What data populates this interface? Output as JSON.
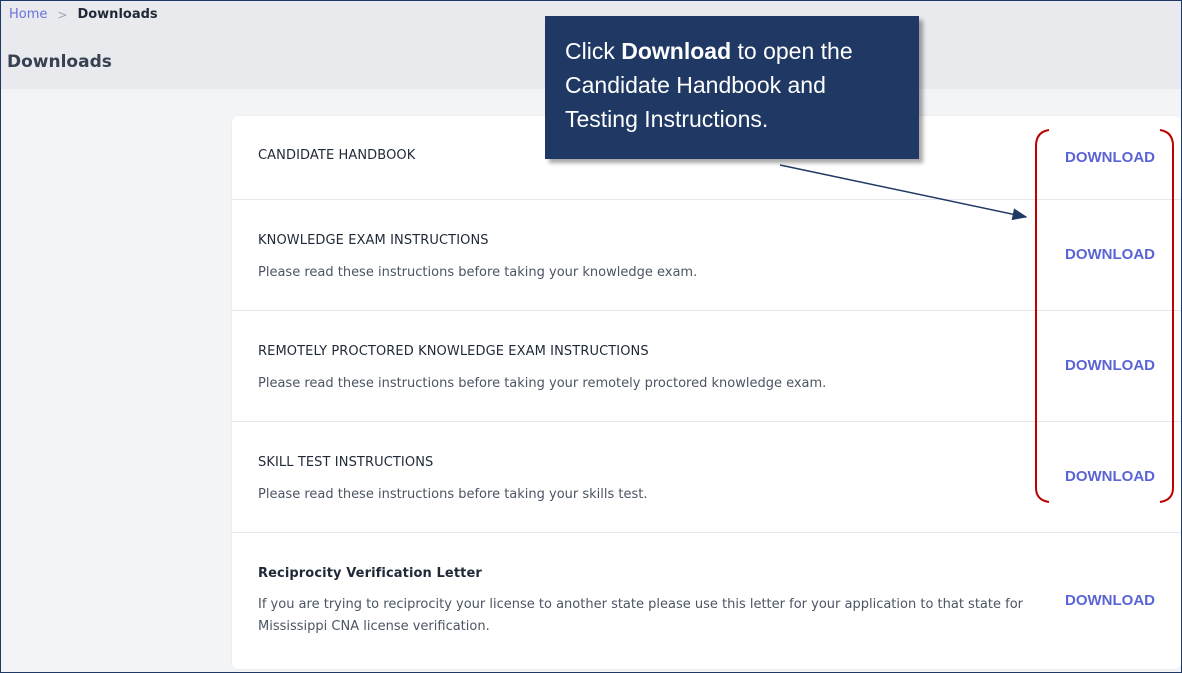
{
  "breadcrumb": {
    "home": "Home",
    "separator": ">",
    "current": "Downloads"
  },
  "page": {
    "title": "Downloads"
  },
  "callout": {
    "prefix": "Click ",
    "bold": "Download",
    "rest": " to open the Candidate Handbook and Testing Instructions."
  },
  "downloads": {
    "rows": [
      {
        "title": "CANDIDATE HANDBOOK",
        "description": "",
        "button": "DOWNLOAD"
      },
      {
        "title": "KNOWLEDGE EXAM INSTRUCTIONS",
        "description": "Please read these instructions before taking your knowledge exam.",
        "button": "DOWNLOAD"
      },
      {
        "title": "REMOTELY PROCTORED KNOWLEDGE EXAM INSTRUCTIONS",
        "description": "Please read these instructions before taking your remotely proctored knowledge exam.",
        "button": "DOWNLOAD"
      },
      {
        "title": "SKILL TEST INSTRUCTIONS",
        "description": "Please read these instructions before taking your skills test.",
        "button": "DOWNLOAD"
      },
      {
        "title": "Reciprocity Verification Letter",
        "description": "If you are trying to reciprocity your license to another state please use this letter for your application to that state for Mississippi CNA license verification.",
        "button": "DOWNLOAD"
      }
    ]
  },
  "colors": {
    "accent": "#5b64d4",
    "callout_bg": "#1f3864",
    "highlight": "#c00000"
  }
}
